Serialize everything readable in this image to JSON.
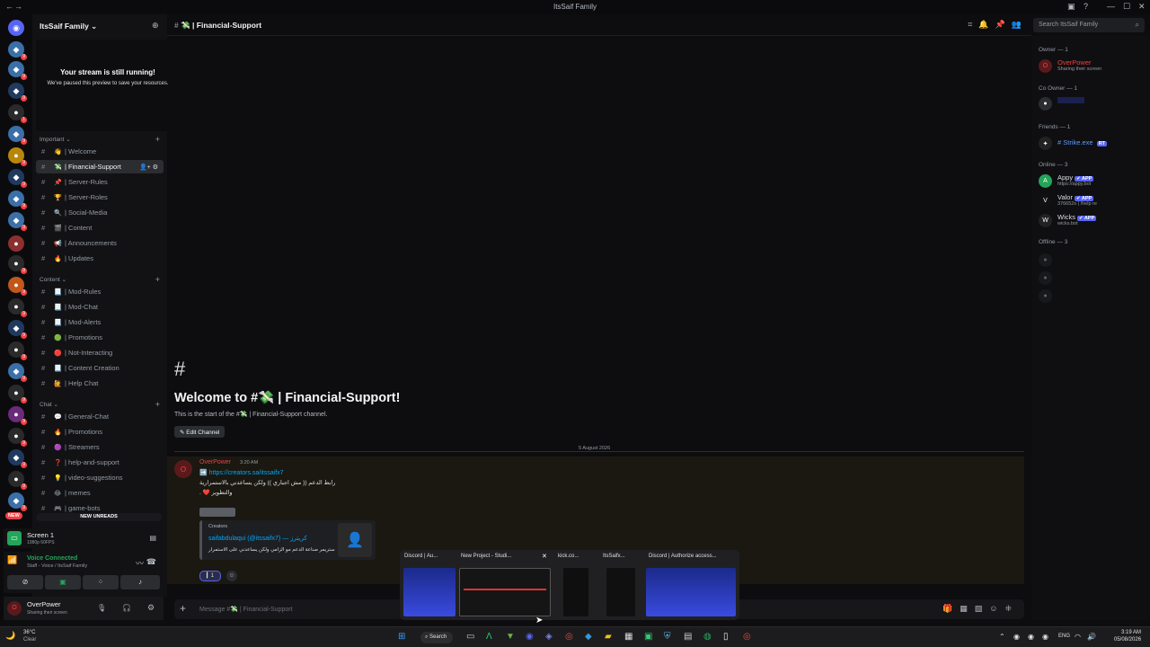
{
  "window": {
    "title": "ItsSaif Family"
  },
  "server": {
    "name": "ItsSaif Family ⌄"
  },
  "stream_notice": {
    "title": "Your stream is still running!",
    "subtitle": "We've paused this preview to save your resources."
  },
  "categories": {
    "important": "Important ⌄",
    "content": "Content ⌄",
    "chat": "Chat ⌄"
  },
  "channels_important": [
    {
      "emoji": "👋",
      "label": "| Welcome"
    },
    {
      "emoji": "💸",
      "label": "| Financial-Support"
    },
    {
      "emoji": "📌",
      "label": "| Server-Rules"
    },
    {
      "emoji": "🏆",
      "label": "| Server-Roles"
    },
    {
      "emoji": "🔍",
      "label": "| Social-Media"
    },
    {
      "emoji": "🎬",
      "label": "| Content"
    },
    {
      "emoji": "📢",
      "label": "| Announcements"
    },
    {
      "emoji": "🔥",
      "label": "| Updates"
    }
  ],
  "channels_content": [
    {
      "emoji": "📃",
      "label": "| Mod-Rules"
    },
    {
      "emoji": "📃",
      "label": "| Mod-Chat"
    },
    {
      "emoji": "📃",
      "label": "| Mod-Alerts"
    },
    {
      "emoji": "🟢",
      "label": "| Promotions"
    },
    {
      "emoji": "🔴",
      "label": "| Not-Interacting"
    },
    {
      "emoji": "📃",
      "label": "| Content Creation"
    },
    {
      "emoji": "🙋",
      "label": "| Help Chat"
    }
  ],
  "channels_chat": [
    {
      "emoji": "💬",
      "label": "| General-Chat"
    },
    {
      "emoji": "🔥",
      "label": "| Promotions"
    },
    {
      "emoji": "🟣",
      "label": "| Streamers"
    },
    {
      "emoji": "❓",
      "label": "| help-and-support"
    },
    {
      "emoji": "💡",
      "label": "| video-suggestions"
    },
    {
      "emoji": "😂",
      "label": "| memes"
    },
    {
      "emoji": "🎮",
      "label": "| game-bots"
    }
  ],
  "new_unreads": "NEW UNREADS",
  "new_badge": "NEW",
  "screen_share": {
    "title": "Screen 1",
    "sub": "1080p 60FPS"
  },
  "voice": {
    "title": "Voice Connected",
    "sub": "Staff - Voice / ItsSaif Family"
  },
  "user": {
    "name": "OverPower",
    "status": "Sharing their screen"
  },
  "header": {
    "channel": "💸 | Financial-Support"
  },
  "search": {
    "placeholder": "Search ItsSaif Family"
  },
  "member_groups": {
    "owner": "Owner — 1",
    "coowner": "Co Owner — 1",
    "friends": "Friends — 1",
    "online": "Online — 3",
    "offline": "Offline — 3"
  },
  "members": {
    "owner": {
      "name": "OverPower",
      "sub": "Sharing their screen"
    },
    "friend": {
      "name": "# Strike.exe",
      "tag": "RT"
    },
    "appy": {
      "name": "Appy",
      "badge": "✔ APP",
      "sub": "https://appy.bot"
    },
    "valor": {
      "name": "Valor",
      "badge": "✔ APP",
      "sub": "376652s | /help re"
    },
    "wicks": {
      "name": "Wicks",
      "badge": "✔ APP",
      "sub": "wicks.bot"
    }
  },
  "welcome": {
    "title": "Welcome to #💸 | Financial-Support!",
    "sub": "This is the start of the #💸 | Financial-Support channel.",
    "edit": "✎ Edit Channel"
  },
  "date_divider": "5 August 2026",
  "message": {
    "author": "OverPower",
    "time": "3:20 AM",
    "link": "➡️ https://creators.sa/itssaifx7",
    "line1": "رابط الدعم (( مش اجباري )) ولكن يساعدني بالاستمرارية",
    "line2": ". ❤️ والتطوير",
    "embed_site": "Creators",
    "embed_title": "saifabdulaqui (@itssaifx7) — كريترز",
    "embed_desc": "ستريمر صناعة الدعم مو الزامي ولكن يساعدني على الاستمرار",
    "reaction_count": "1"
  },
  "composer": {
    "placeholder": "Message #💸 | Financial-Support"
  },
  "taskbar_thumbs": [
    {
      "label": "Discord | Au..."
    },
    {
      "label": "New Project - Studi..."
    },
    {
      "label": "kick.co..."
    },
    {
      "label": "ItsSaifx..."
    },
    {
      "label": "Discord | Authorize access..."
    }
  ],
  "taskbar": {
    "weather_temp": "36°C",
    "weather_desc": "Clear",
    "search": "Search",
    "lang": "ENG",
    "time": "3:19 AM",
    "date": "05/08/2026"
  },
  "colors": {
    "accent": "#5865f2",
    "danger": "#f23f43",
    "link": "#00a8fc",
    "online": "#23a55a"
  }
}
